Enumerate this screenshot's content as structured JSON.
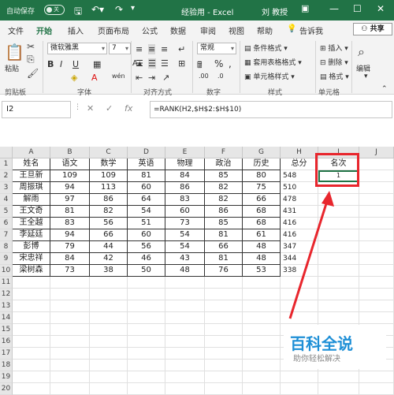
{
  "titlebar": {
    "autosave_label": "自动保存",
    "autosave_state": "关",
    "title": "经验用 - Excel",
    "user": "刘 教授"
  },
  "tabs": [
    "文件",
    "开始",
    "插入",
    "页面布局",
    "公式",
    "数据",
    "审阅",
    "视图",
    "帮助"
  ],
  "active_tab": "开始",
  "tell_me": "告诉我",
  "share_label": "共享",
  "ribbon": {
    "paste_label": "粘贴",
    "font_name": "微软雅黑",
    "font_size": "7",
    "number_format": "常规",
    "conditional_format": "条件格式",
    "table_format": "套用表格格式",
    "cell_style": "单元格样式",
    "insert": "插入",
    "delete": "删除",
    "format": "格式",
    "edit": "编辑",
    "groups": [
      "剪贴板",
      "字体",
      "对齐方式",
      "数字",
      "样式",
      "单元格"
    ]
  },
  "formula_bar": {
    "name_box": "I2",
    "formula": "=RANK(H2,$H$2:$H$10)"
  },
  "grid": {
    "columns": [
      "A",
      "B",
      "C",
      "D",
      "E",
      "F",
      "G",
      "H",
      "I",
      "J"
    ],
    "rows": [
      "1",
      "2",
      "3",
      "4",
      "5",
      "6",
      "7",
      "8",
      "9",
      "10",
      "11",
      "12",
      "13",
      "14",
      "15",
      "16",
      "17",
      "18",
      "19",
      "20"
    ],
    "header": [
      "姓名",
      "语文",
      "数学",
      "英语",
      "物理",
      "政治",
      "历史",
      "总分",
      "名次"
    ],
    "data": [
      [
        "王旦新",
        "109",
        "109",
        "81",
        "84",
        "85",
        "80",
        "548",
        "1"
      ],
      [
        "周振琪",
        "94",
        "113",
        "60",
        "86",
        "82",
        "75",
        "510",
        ""
      ],
      [
        "解雨",
        "97",
        "86",
        "64",
        "83",
        "82",
        "66",
        "478",
        ""
      ],
      [
        "王文奇",
        "81",
        "82",
        "54",
        "60",
        "86",
        "68",
        "431",
        ""
      ],
      [
        "王全越",
        "83",
        "56",
        "51",
        "73",
        "85",
        "68",
        "416",
        ""
      ],
      [
        "李延廷",
        "94",
        "66",
        "60",
        "54",
        "81",
        "61",
        "416",
        ""
      ],
      [
        "彭博",
        "79",
        "44",
        "56",
        "54",
        "66",
        "48",
        "347",
        ""
      ],
      [
        "宋忠祥",
        "84",
        "42",
        "46",
        "43",
        "81",
        "48",
        "344",
        ""
      ],
      [
        "梁树森",
        "73",
        "38",
        "50",
        "48",
        "76",
        "53",
        "338",
        ""
      ]
    ]
  },
  "watermark": {
    "brand": "百科全说",
    "tagline": "助你轻松解决"
  },
  "colors": {
    "excel_green": "#217346",
    "annotation_red": "#e8262d",
    "watermark_blue": "#1e8fd6"
  }
}
